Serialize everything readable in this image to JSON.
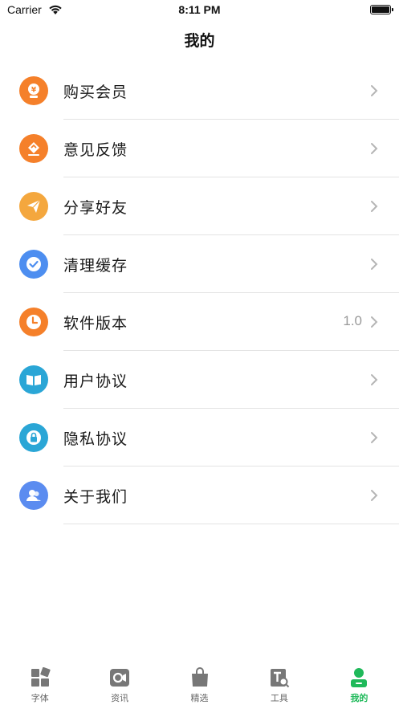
{
  "status_bar": {
    "carrier": "Carrier",
    "time": "8:11 PM",
    "wifi_icon": "wifi-icon",
    "battery_icon": "battery-icon"
  },
  "header": {
    "title": "我的"
  },
  "menu": {
    "items": [
      {
        "label": "购买会员",
        "icon": "vip-yen-icon",
        "icon_color": "#F5802A",
        "value": ""
      },
      {
        "label": "意见反馈",
        "icon": "feedback-icon",
        "icon_color": "#F5802A",
        "value": ""
      },
      {
        "label": "分享好友",
        "icon": "paper-plane-icon",
        "icon_color": "#F4A73E",
        "value": ""
      },
      {
        "label": "清理缓存",
        "icon": "check-circle-icon",
        "icon_color": "#4D8EF0",
        "value": ""
      },
      {
        "label": "软件版本",
        "icon": "clock-icon",
        "icon_color": "#F5802A",
        "value": "1.0"
      },
      {
        "label": "用户协议",
        "icon": "book-icon",
        "icon_color": "#2AA6D6",
        "value": ""
      },
      {
        "label": "隐私协议",
        "icon": "lock-icon",
        "icon_color": "#2AA6D6",
        "value": ""
      },
      {
        "label": "关于我们",
        "icon": "users-icon",
        "icon_color": "#5B8CF0",
        "value": ""
      }
    ],
    "chevron_icon": "chevron-right-icon"
  },
  "tab_bar": {
    "tabs": [
      {
        "label": "字体",
        "icon": "grid-icon",
        "active": false
      },
      {
        "label": "资讯",
        "icon": "video-icon",
        "active": false
      },
      {
        "label": "精选",
        "icon": "shopping-bag-icon",
        "active": false
      },
      {
        "label": "工具",
        "icon": "text-search-icon",
        "active": false
      },
      {
        "label": "我的",
        "icon": "user-icon",
        "active": true
      }
    ],
    "active_color": "#1FB95A",
    "inactive_color": "#666666"
  }
}
